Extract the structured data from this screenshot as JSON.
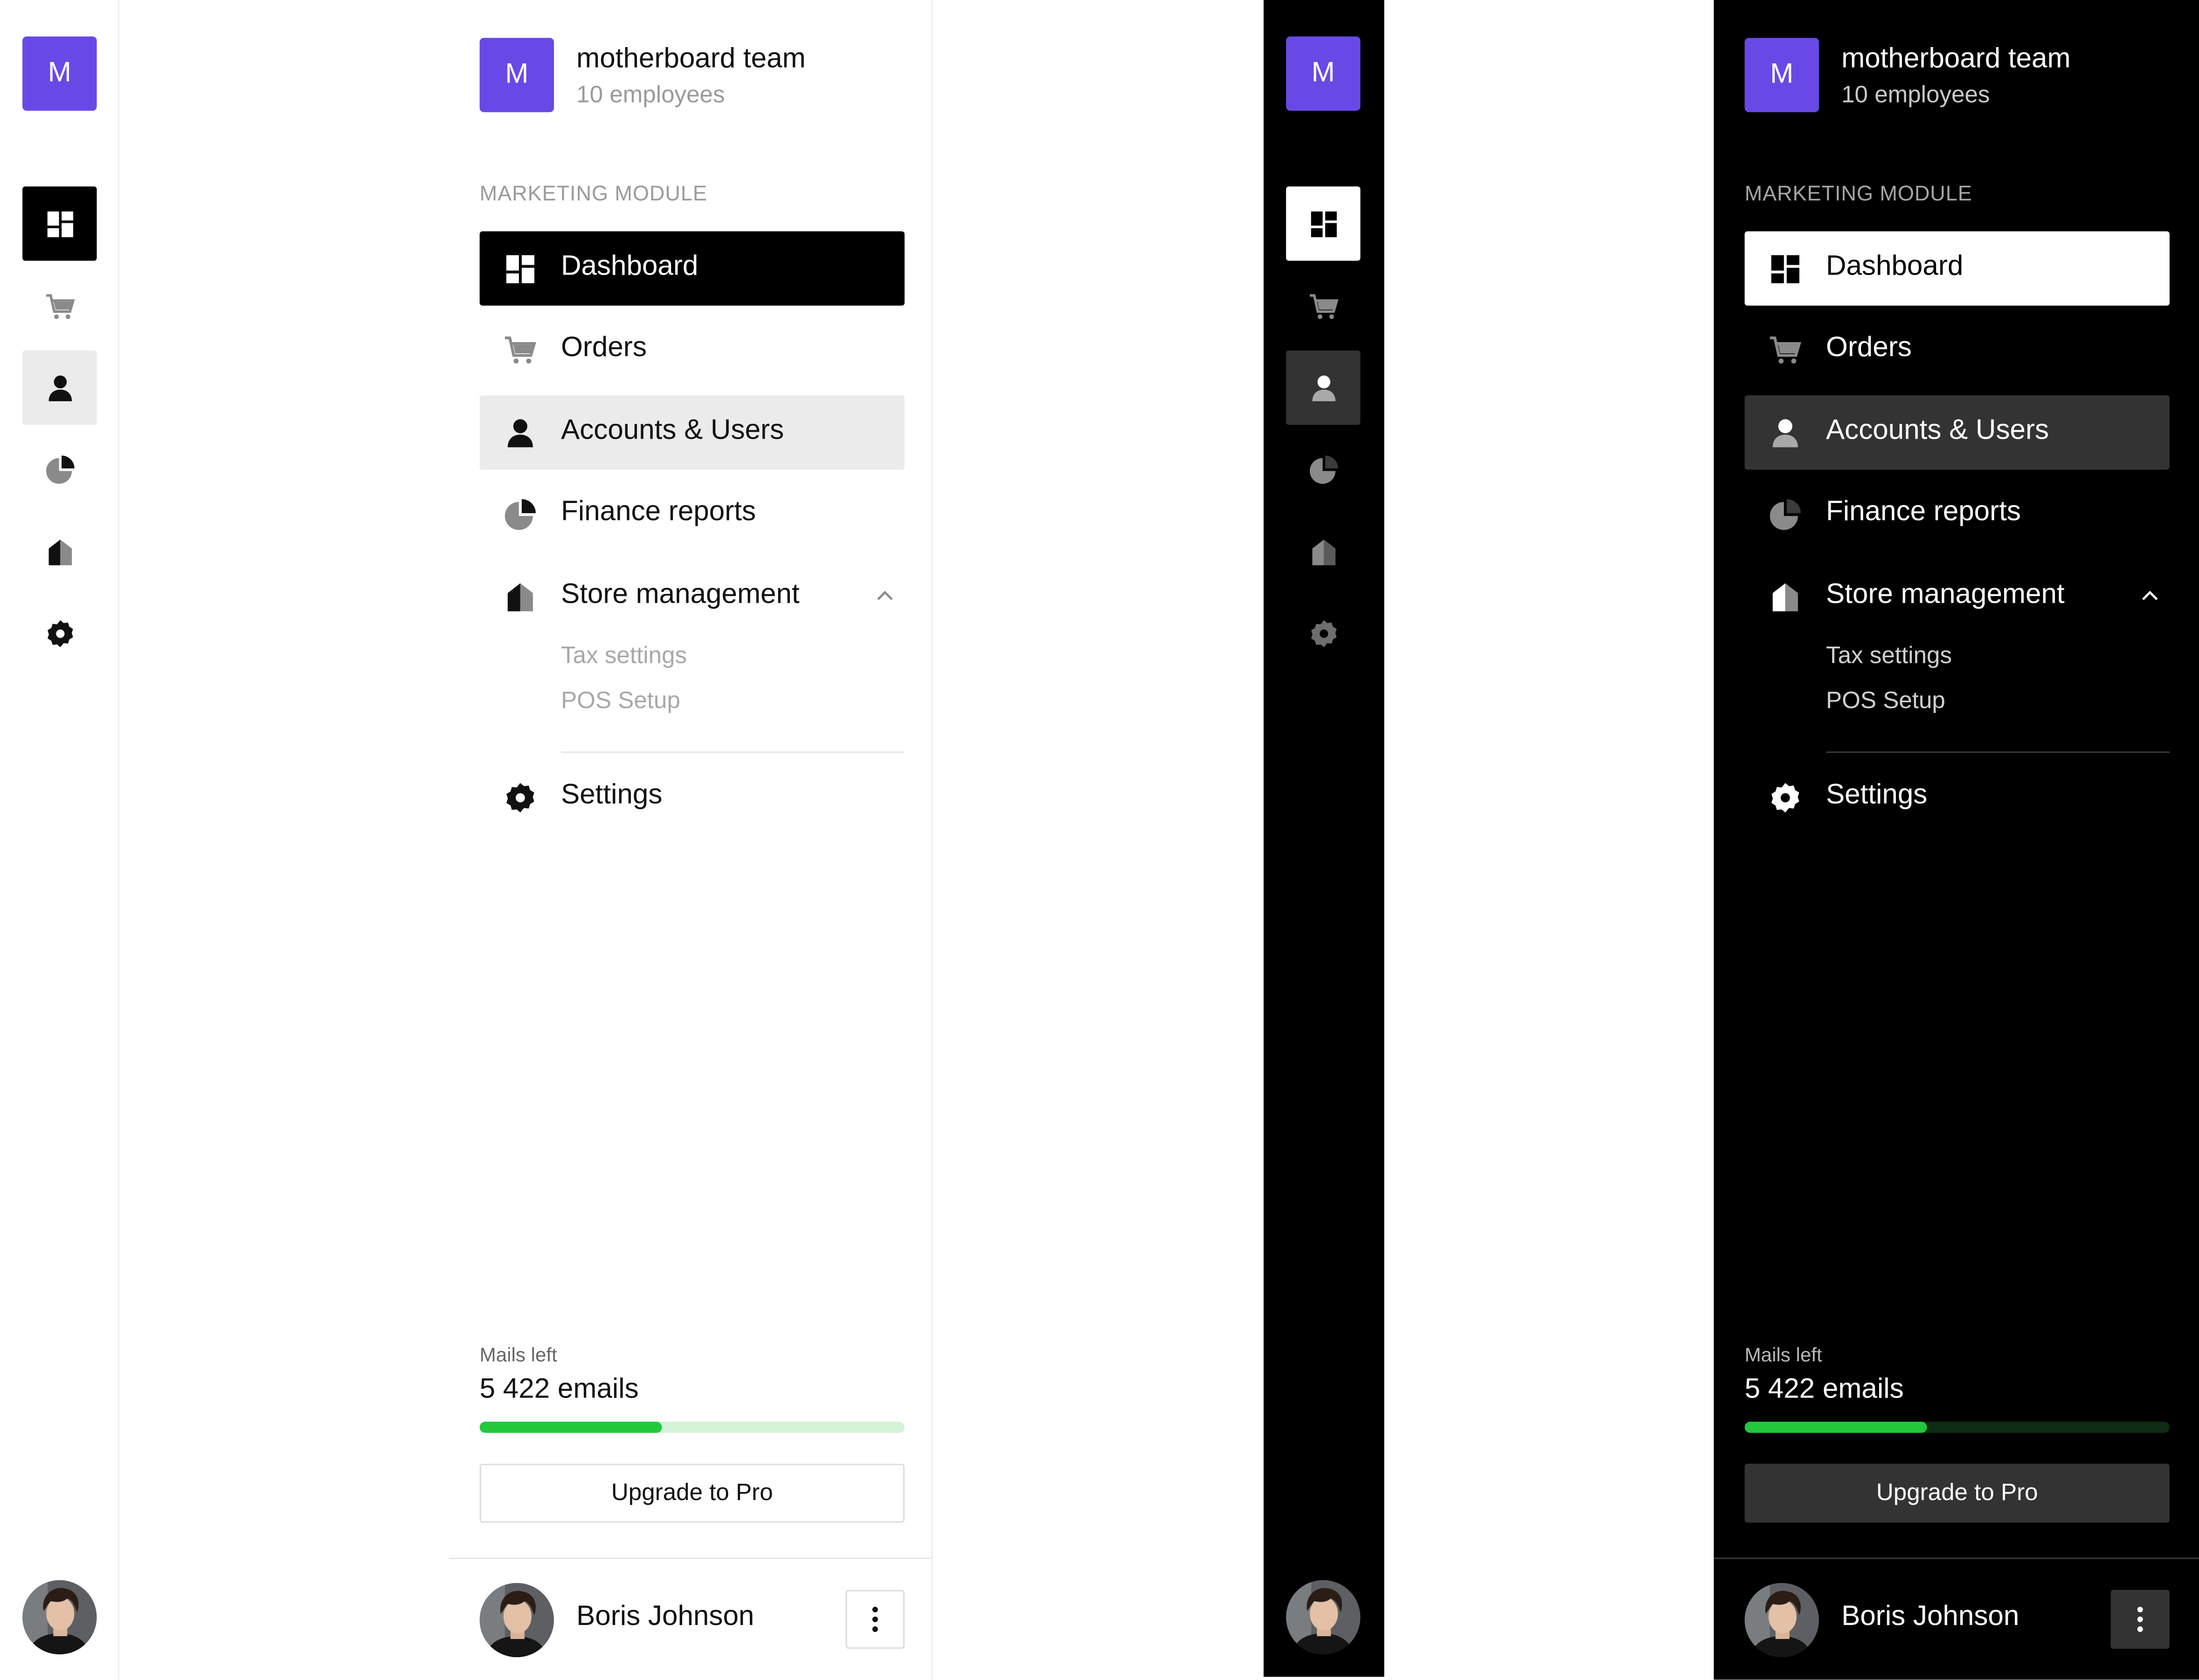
{
  "brand": {
    "initial": "M",
    "team_name": "motherboard team",
    "team_subtitle": "10 employees",
    "logo_color": "#6949e6"
  },
  "section_label": "MARKETING MODULE",
  "nav": {
    "dashboard": "Dashboard",
    "orders": "Orders",
    "accounts": "Accounts & Users",
    "finance": "Finance reports",
    "store": "Store management",
    "tax": "Tax settings",
    "pos": "POS Setup",
    "settings": "Settings"
  },
  "nav_icons": [
    "dashboard-icon",
    "cart-icon",
    "user-icon",
    "pie-chart-icon",
    "store-icon",
    "gear-icon"
  ],
  "active_item": "Dashboard",
  "highlighted_item": "Accounts & Users",
  "mails": {
    "label": "Mails left",
    "value": "5 422 emails",
    "progress": 0.43,
    "accent": "#21c93a"
  },
  "upgrade_label": "Upgrade to Pro",
  "user": {
    "name": "Boris Johnson"
  },
  "themes": [
    "light",
    "dark"
  ]
}
